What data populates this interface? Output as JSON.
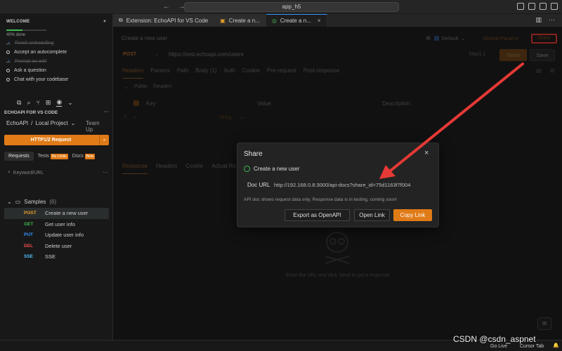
{
  "titlebar": {
    "search_text": "app_h5",
    "back": "←",
    "forward": "→"
  },
  "welcome": {
    "heading": "WELCOME",
    "close": "×",
    "progress_percent": 40,
    "progress_text": "40% done",
    "items": [
      {
        "label": "Finish onboarding",
        "done": true
      },
      {
        "label": "Accept an autocomplete",
        "done": false
      },
      {
        "label": "Prompt an edit",
        "done": true
      },
      {
        "label": "Ask a question",
        "done": false
      },
      {
        "label": "Chat with your codebase",
        "done": false
      }
    ]
  },
  "sidebar": {
    "section_title": "ECHOAPI FOR VS CODE",
    "project_root": "EchoAPI",
    "project_sep": "/",
    "project_name": "Local Project",
    "team": "Team Up",
    "new_request_button": "HTTP1/2 Request",
    "tabs": {
      "requests": "Requests",
      "tests": "Tests",
      "no_limits": "No Limits",
      "docs": "Docs",
      "beta": "Beta"
    },
    "search_placeholder": "Keyword/URL",
    "folder_name": "Samples",
    "folder_count": "(6)",
    "requests": [
      {
        "method": "POST",
        "name": "Create a new user",
        "color": "#e5a02b"
      },
      {
        "method": "GET",
        "name": "Get user info",
        "color": "#3fb950"
      },
      {
        "method": "PUT",
        "name": "Update user info",
        "color": "#3794ff"
      },
      {
        "method": "DEL",
        "name": "Delete user",
        "color": "#f14c4c"
      },
      {
        "method": "SSE",
        "name": "SSE",
        "color": "#4fc1ff"
      }
    ]
  },
  "tabs": [
    {
      "label": "Extension: EchoAPI for VS Code"
    },
    {
      "label": "Create a n..."
    },
    {
      "label": "Create a n..."
    }
  ],
  "editor": {
    "request_title": "Create a new user",
    "environment": "Default",
    "global_params": "Global Params",
    "share": "Share",
    "method": "POST",
    "url": "https://rest.echoapi.com/users",
    "http_version": "http/1.1",
    "send": "Send",
    "save": "Save",
    "request_tabs": [
      "Headers",
      "Params",
      "Path",
      "Body",
      "Auth",
      "Cookie",
      "Pre-request",
      "Post-response"
    ],
    "body_count": "(1)",
    "public_header": "Public",
    "public_header_sub": "(header)",
    "columns": {
      "key": "Key",
      "value": "Value",
      "description": "Description"
    },
    "row_type": "String",
    "response_tabs": [
      "Response",
      "Headers",
      "Cookie",
      "Actual Re..."
    ],
    "empty_text": "Enter the URL and click Send to get a response"
  },
  "dialog": {
    "title": "Share",
    "close": "×",
    "request_name": "Create a new user",
    "doc_label": "Doc URL",
    "doc_url": "http://192.168.0.8:3000/api-docs?share_id=75d1163f7f004",
    "note": "API doc shows request data only. Response data is in testing, coming soon!",
    "export_button": "Export as OpenAPI",
    "open_button": "Open Link",
    "copy_button": "Copy Link"
  },
  "statusbar": {
    "go_live": "Go Live",
    "cursor_tab": "Cursor Tab"
  },
  "watermark": "CSDN @csdn_aspnet",
  "colors": {
    "accent": "#e07b17",
    "annotation_red": "#e53935",
    "progress_green": "#3fb950"
  }
}
